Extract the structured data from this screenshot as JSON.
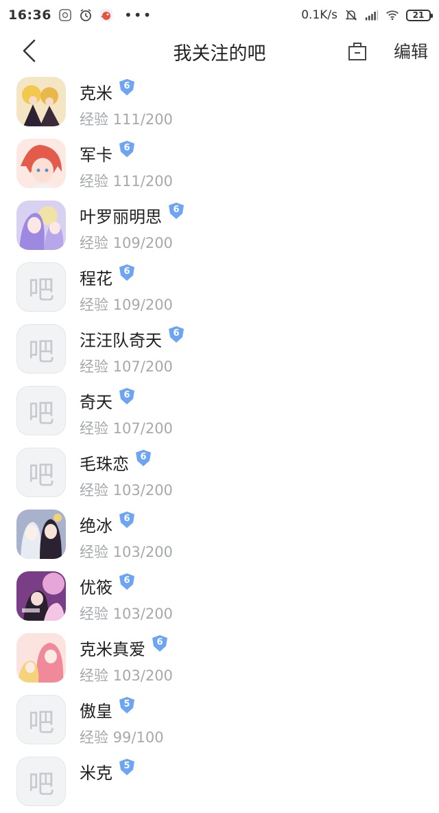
{
  "status_bar": {
    "time": "16:36",
    "net_speed": "0.1K/s",
    "battery": "21",
    "more": "•••"
  },
  "header": {
    "title": "我关注的吧",
    "edit_label": "编辑"
  },
  "placeholder_char": "吧",
  "colors": {
    "badge_blue": "#6ea4f4",
    "exp_gray": "#a5a8ad",
    "placeholder_bg": "#f2f3f5"
  },
  "items": [
    {
      "name": "克米",
      "level": "6",
      "exp": "经验 111/200",
      "avatar": "image"
    },
    {
      "name": "军卡",
      "level": "6",
      "exp": "经验 111/200",
      "avatar": "image"
    },
    {
      "name": "叶罗丽明思",
      "level": "6",
      "exp": "经验 109/200",
      "avatar": "image"
    },
    {
      "name": "程花",
      "level": "6",
      "exp": "经验 109/200",
      "avatar": "placeholder"
    },
    {
      "name": "汪汪队奇天",
      "level": "6",
      "exp": "经验 107/200",
      "avatar": "placeholder"
    },
    {
      "name": "奇天",
      "level": "6",
      "exp": "经验 107/200",
      "avatar": "placeholder"
    },
    {
      "name": "毛珠恋",
      "level": "6",
      "exp": "经验 103/200",
      "avatar": "placeholder"
    },
    {
      "name": "绝冰",
      "level": "6",
      "exp": "经验 103/200",
      "avatar": "image"
    },
    {
      "name": "优筱",
      "level": "6",
      "exp": "经验 103/200",
      "avatar": "image"
    },
    {
      "name": "克米真爱",
      "level": "6",
      "exp": "经验 103/200",
      "avatar": "image"
    },
    {
      "name": "傲皇",
      "level": "5",
      "exp": "经验 99/100",
      "avatar": "placeholder"
    },
    {
      "name": "米克",
      "level": "5",
      "exp": "",
      "avatar": "placeholder"
    }
  ]
}
